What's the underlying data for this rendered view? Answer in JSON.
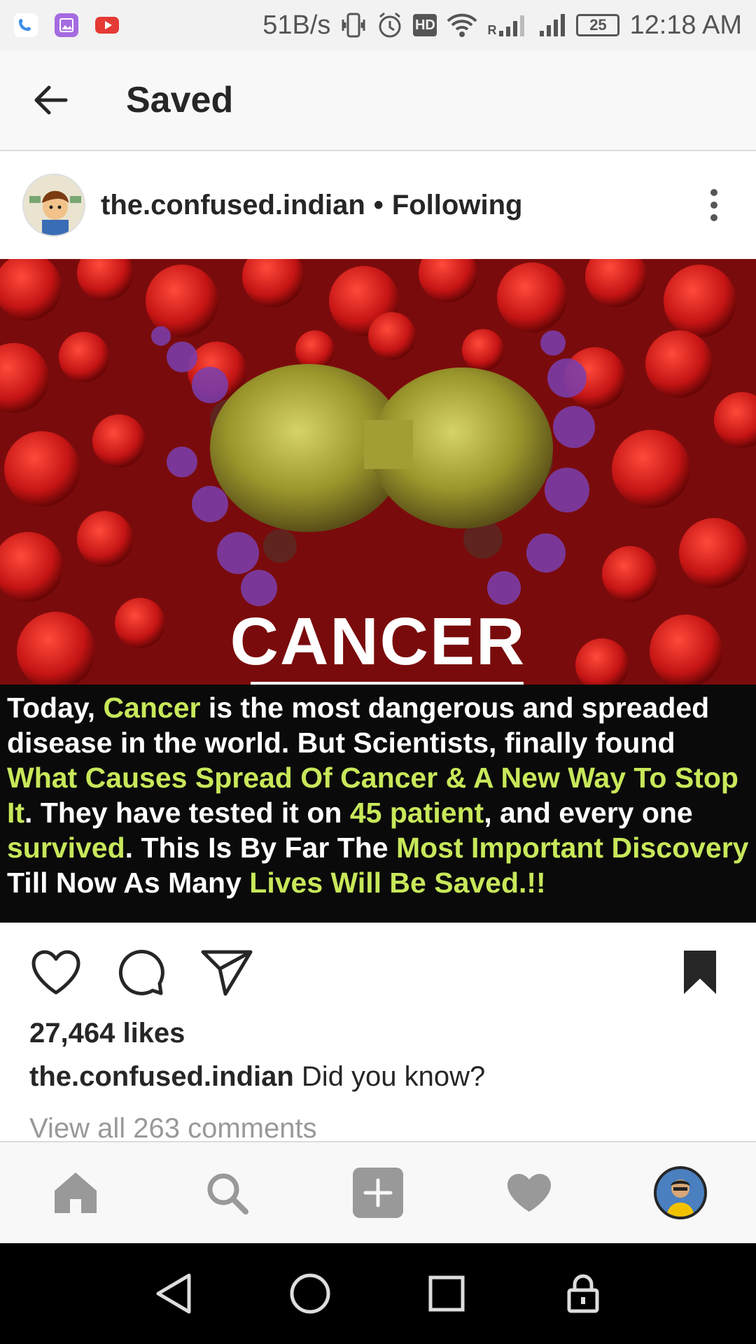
{
  "status_bar": {
    "net_speed": "51B/s",
    "battery": "25",
    "time": "12:18 AM",
    "hd": "HD",
    "roaming": "R"
  },
  "header": {
    "title": "Saved"
  },
  "post": {
    "username": "the.confused.indian",
    "separator": "•",
    "follow_status": "Following",
    "image": {
      "title": "CANCER",
      "caption_segments": [
        {
          "text": "Today, ",
          "hl": false
        },
        {
          "text": "Cancer",
          "hl": true
        },
        {
          "text": " is the most dangerous and spreaded disease in the world. But Scientists, finally found ",
          "hl": false
        },
        {
          "text": "What Causes Spread Of Cancer & A New Way To Stop It",
          "hl": true
        },
        {
          "text": ". They have tested it on ",
          "hl": false
        },
        {
          "text": "45 patient",
          "hl": true
        },
        {
          "text": ", and every one ",
          "hl": false
        },
        {
          "text": "survived",
          "hl": true
        },
        {
          "text": ". This Is By Far The ",
          "hl": false
        },
        {
          "text": "Most Important Discovery",
          "hl": true
        },
        {
          "text": " Till Now As Many ",
          "hl": false
        },
        {
          "text": "Lives Will Be Saved.!!",
          "hl": true
        }
      ]
    },
    "likes": "27,464 likes",
    "caption_user": "the.confused.indian",
    "caption_text": "Did you know?",
    "comments_link": "View all 263 comments"
  },
  "colors": {
    "highlight": "#c8e85a",
    "accent_text": "#262626",
    "muted": "#999999"
  },
  "icons": {
    "back": "arrow-left-icon",
    "more": "more-vertical-icon",
    "like": "heart-outline-icon",
    "comment": "comment-icon",
    "share": "send-icon",
    "save": "bookmark-filled-icon",
    "nav_home": "home-icon",
    "nav_search": "search-icon",
    "nav_add": "add-icon",
    "nav_activity": "heart-icon",
    "sys_back": "triangle-back-icon",
    "sys_home": "circle-home-icon",
    "sys_recent": "square-recents-icon",
    "sys_lock": "lock-icon"
  }
}
